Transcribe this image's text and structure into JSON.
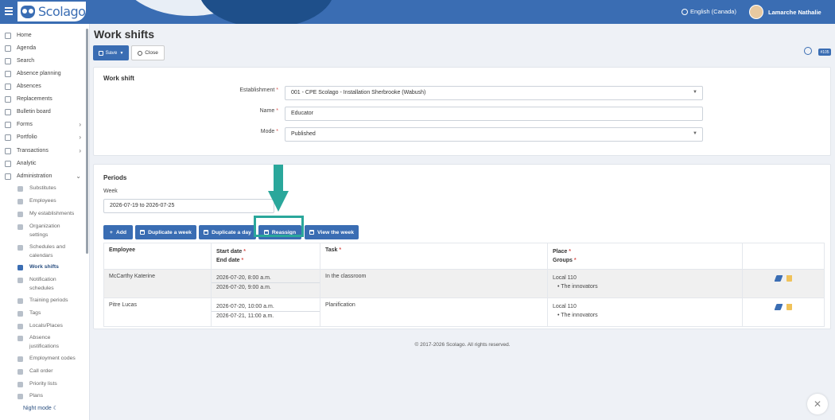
{
  "header": {
    "app_name": "Scolago",
    "language": "English (Canada)",
    "user_name": "Lamarche Nathalie"
  },
  "sidebar": {
    "items": [
      {
        "label": "Home",
        "icon": "home-icon"
      },
      {
        "label": "Agenda",
        "icon": "calendar-icon"
      },
      {
        "label": "Search",
        "icon": "search-icon"
      },
      {
        "label": "Absence planning",
        "icon": "calendar-icon"
      },
      {
        "label": "Absences",
        "icon": "user-clock-icon"
      },
      {
        "label": "Replacements",
        "icon": "swap-icon"
      },
      {
        "label": "Bulletin board",
        "icon": "board-icon"
      },
      {
        "label": "Forms",
        "icon": "form-icon",
        "chevron": "›"
      },
      {
        "label": "Portfolio",
        "icon": "trophy-icon",
        "chevron": "›"
      },
      {
        "label": "Transactions",
        "icon": "transactions-icon",
        "chevron": "›"
      },
      {
        "label": "Analytic",
        "icon": "chart-icon"
      },
      {
        "label": "Administration",
        "icon": "gear-icon",
        "chevron": "⌄"
      }
    ],
    "sub_items": [
      {
        "label": "Substitutes",
        "icon": "user-icon"
      },
      {
        "label": "Employees",
        "icon": "users-icon"
      },
      {
        "label": "My establishments",
        "icon": "building-icon"
      },
      {
        "label": "Organization settings",
        "icon": "settings-icon"
      },
      {
        "label": "Schedules and calendars",
        "icon": "schedule-icon"
      },
      {
        "label": "Work shifts",
        "icon": "work-shift-icon",
        "active": true
      },
      {
        "label": "Notification schedules",
        "icon": "bell-icon"
      },
      {
        "label": "Training periods",
        "icon": "refresh-icon"
      },
      {
        "label": "Tags",
        "icon": "tag-icon"
      },
      {
        "label": "Locals/Places",
        "icon": "map-pin-icon"
      },
      {
        "label": "Absence justifications",
        "icon": "document-icon"
      },
      {
        "label": "Employment codes",
        "icon": "code-icon"
      },
      {
        "label": "Call order",
        "icon": "phone-icon"
      },
      {
        "label": "Priority lists",
        "icon": "list-icon"
      },
      {
        "label": "Plans",
        "icon": "plan-icon"
      }
    ],
    "night_mode": "Night mode"
  },
  "page": {
    "title": "Work shifts",
    "save_label": "Save",
    "close_label": "Close",
    "id_badge": "#105"
  },
  "work_shift": {
    "title": "Work shift",
    "establishment_label": "Establishment",
    "establishment_value": "001 - CPE Scolago - Installation Sherbrooke (Wabush)",
    "name_label": "Name",
    "name_value": "Educator",
    "mode_label": "Mode",
    "mode_value": "Published"
  },
  "periods": {
    "title": "Periods",
    "week_label": "Week",
    "week_value": "2026-07-19 to 2026-07-25",
    "buttons": {
      "add": "Add",
      "duplicate_week": "Duplicate a week",
      "duplicate_day": "Duplicate a day",
      "reassign": "Reassign",
      "view_week": "View the week"
    },
    "table": {
      "headers": {
        "employee": "Employee",
        "start_date": "Start date",
        "end_date": "End date",
        "task": "Task",
        "place": "Place",
        "groups": "Groups"
      },
      "rows": [
        {
          "employee": "McCarthy Katerine",
          "start": "2026-07-20, 8:00 a.m.",
          "end": "2026-07-20, 9:00 a.m.",
          "task": "In the classroom",
          "place": "Local 110",
          "group": "The innovators"
        },
        {
          "employee": "Pitre Lucas",
          "start": "2026-07-20, 10:00 a.m.",
          "end": "2026-07-21, 11:00 a.m.",
          "task": "Planification",
          "place": "Local 110",
          "group": "The innovators"
        }
      ]
    }
  },
  "footer": "© 2017-2026 Scolago. All rights reserved.",
  "colors": {
    "brand": "#3a6db3",
    "highlight": "#2aa79b",
    "required": "#d9534f"
  }
}
